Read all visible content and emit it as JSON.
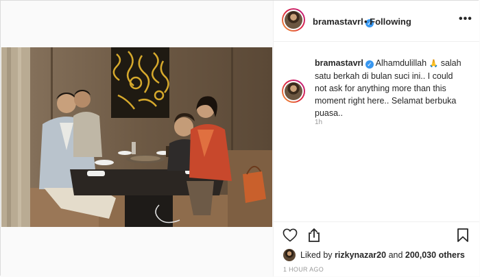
{
  "post": {
    "username": "bramastavrl",
    "verified_mark": "✓",
    "following_label": "• Following",
    "more_icon": "more-horizontal-icon",
    "caption": {
      "text": "Alhamdulillah",
      "emoji": "🙏",
      "text_rest": " salah satu berkah di bulan suci ini.. I could not ask for anything more than this moment right here.. Selamat berbuka puasa.."
    },
    "caption_time": "1h",
    "likes": {
      "prefix": "Liked by ",
      "user": "rizkynazar20",
      "middle": " and ",
      "count": "200,030 others"
    },
    "post_time": "1 HOUR AGO"
  },
  "icons": {
    "like": "heart-icon",
    "share": "share-icon",
    "save": "bookmark-icon"
  },
  "colors": {
    "border": "#dbdbdb",
    "text": "#262626",
    "muted": "#999999",
    "verified": "#3897f0"
  }
}
